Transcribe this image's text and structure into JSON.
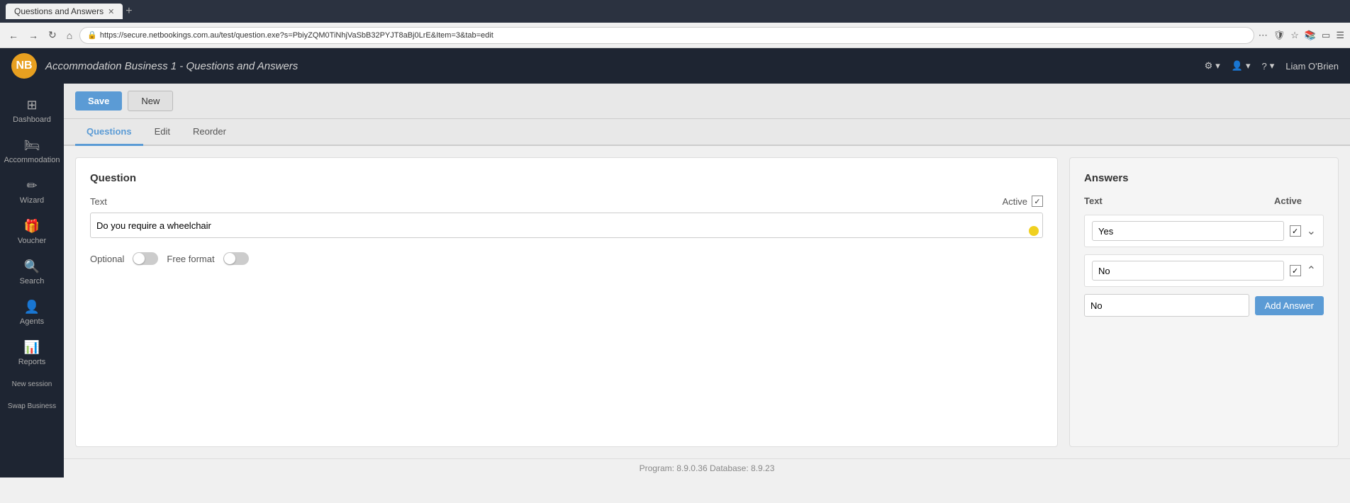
{
  "browser": {
    "tab_label": "Questions and Answers",
    "url": "https://secure.netbookings.com.au/test/question.exe?s=PbiyZQM0TiNhjVaSbB32PYJT8aBj0LrE&Item=3&tab=edit",
    "new_tab_icon": "+"
  },
  "app_header": {
    "logo_text": "NB",
    "title": "Accommodation Business 1",
    "separator": " - ",
    "subtitle": "Questions and Answers",
    "settings_label": "Settings",
    "user_label": "User",
    "help_label": "Help",
    "username": "Liam O'Brien"
  },
  "sidebar": {
    "items": [
      {
        "id": "dashboard",
        "label": "Dashboard",
        "icon": "⊞"
      },
      {
        "id": "accommodation",
        "label": "Accommodation",
        "icon": "🛏"
      },
      {
        "id": "wizard",
        "label": "Wizard",
        "icon": "✏"
      },
      {
        "id": "voucher",
        "label": "Voucher",
        "icon": "🎁"
      },
      {
        "id": "search",
        "label": "Search",
        "icon": "🔍"
      },
      {
        "id": "agents",
        "label": "Agents",
        "icon": "👤"
      },
      {
        "id": "reports",
        "label": "Reports",
        "icon": "📊"
      },
      {
        "id": "new-session",
        "label": "New session",
        "icon": ""
      },
      {
        "id": "swap-business",
        "label": "Swap Business",
        "icon": ""
      }
    ]
  },
  "toolbar": {
    "save_label": "Save",
    "new_label": "New"
  },
  "tabs": [
    {
      "id": "questions",
      "label": "Questions",
      "active": true
    },
    {
      "id": "edit",
      "label": "Edit",
      "active": false
    },
    {
      "id": "reorder",
      "label": "Reorder",
      "active": false
    }
  ],
  "question_panel": {
    "title": "Question",
    "text_label": "Text",
    "active_label": "Active",
    "active_checked": true,
    "question_value": "Do you require a wheelchair",
    "optional_label": "Optional",
    "optional_on": false,
    "free_format_label": "Free format",
    "free_format_on": false
  },
  "answers_panel": {
    "title": "Answers",
    "col_text": "Text",
    "col_active": "Active",
    "answers": [
      {
        "text": "Yes",
        "active": true,
        "has_down": true,
        "has_up": false
      },
      {
        "text": "No",
        "active": true,
        "has_down": false,
        "has_up": true
      }
    ],
    "new_answer_value": "No",
    "add_answer_label": "Add Answer"
  },
  "footer": {
    "text": "Program: 8.9.0.36 Database: 8.9.23"
  }
}
